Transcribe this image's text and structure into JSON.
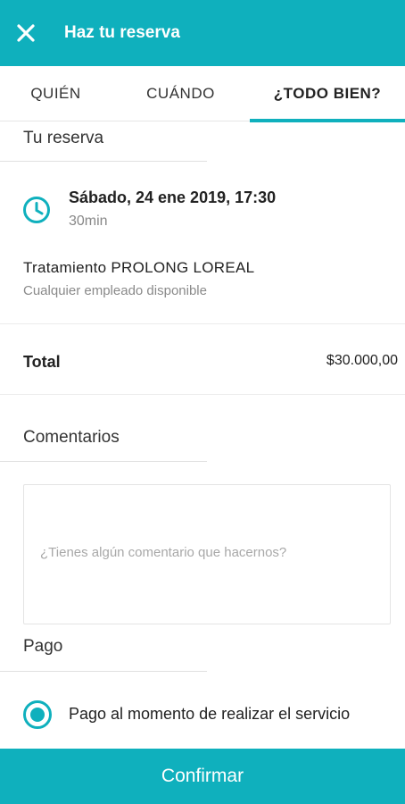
{
  "app_bar": {
    "title": "Haz tu reserva",
    "close_icon": "close-icon",
    "background": "#0fb0bd"
  },
  "tabs": [
    {
      "label": "QUIÉN",
      "active": false
    },
    {
      "label": "CUÁNDO",
      "active": false
    },
    {
      "label": "¿TODO BIEN?",
      "active": true
    }
  ],
  "reservation": {
    "section_title": "Tu reserva",
    "icon": "clock-icon",
    "date": "Sábado, 24 ene 2019, 17:30",
    "duration": "30min",
    "service_name": "Tratamiento PROLONG LOREAL",
    "employee": "Cualquier empleado disponible"
  },
  "total": {
    "label": "Total",
    "value": "$30.000,00"
  },
  "comments": {
    "section_title": "Comentarios",
    "value": "",
    "placeholder": "¿Tienes algún comentario que hacernos?"
  },
  "payment": {
    "section_title": "Pago",
    "option_label": "Pago al momento de realizar el servicio",
    "selected": true
  },
  "confirm_button": {
    "label": "Confirmar"
  }
}
